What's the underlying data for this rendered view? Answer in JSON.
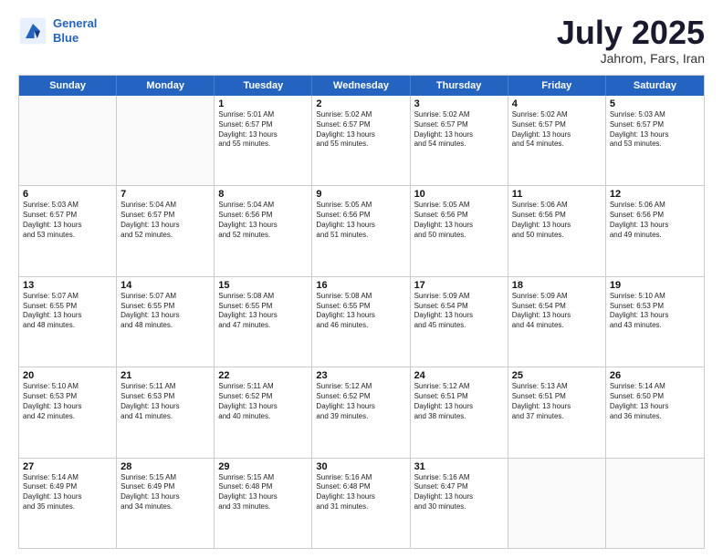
{
  "header": {
    "logo_line1": "General",
    "logo_line2": "Blue",
    "month": "July 2025",
    "location": "Jahrom, Fars, Iran"
  },
  "days": [
    "Sunday",
    "Monday",
    "Tuesday",
    "Wednesday",
    "Thursday",
    "Friday",
    "Saturday"
  ],
  "weeks": [
    [
      {
        "day": "",
        "empty": true
      },
      {
        "day": "",
        "empty": true
      },
      {
        "day": "1",
        "l1": "Sunrise: 5:01 AM",
        "l2": "Sunset: 6:57 PM",
        "l3": "Daylight: 13 hours",
        "l4": "and 55 minutes."
      },
      {
        "day": "2",
        "l1": "Sunrise: 5:02 AM",
        "l2": "Sunset: 6:57 PM",
        "l3": "Daylight: 13 hours",
        "l4": "and 55 minutes."
      },
      {
        "day": "3",
        "l1": "Sunrise: 5:02 AM",
        "l2": "Sunset: 6:57 PM",
        "l3": "Daylight: 13 hours",
        "l4": "and 54 minutes."
      },
      {
        "day": "4",
        "l1": "Sunrise: 5:02 AM",
        "l2": "Sunset: 6:57 PM",
        "l3": "Daylight: 13 hours",
        "l4": "and 54 minutes."
      },
      {
        "day": "5",
        "l1": "Sunrise: 5:03 AM",
        "l2": "Sunset: 6:57 PM",
        "l3": "Daylight: 13 hours",
        "l4": "and 53 minutes."
      }
    ],
    [
      {
        "day": "6",
        "l1": "Sunrise: 5:03 AM",
        "l2": "Sunset: 6:57 PM",
        "l3": "Daylight: 13 hours",
        "l4": "and 53 minutes."
      },
      {
        "day": "7",
        "l1": "Sunrise: 5:04 AM",
        "l2": "Sunset: 6:57 PM",
        "l3": "Daylight: 13 hours",
        "l4": "and 52 minutes."
      },
      {
        "day": "8",
        "l1": "Sunrise: 5:04 AM",
        "l2": "Sunset: 6:56 PM",
        "l3": "Daylight: 13 hours",
        "l4": "and 52 minutes."
      },
      {
        "day": "9",
        "l1": "Sunrise: 5:05 AM",
        "l2": "Sunset: 6:56 PM",
        "l3": "Daylight: 13 hours",
        "l4": "and 51 minutes."
      },
      {
        "day": "10",
        "l1": "Sunrise: 5:05 AM",
        "l2": "Sunset: 6:56 PM",
        "l3": "Daylight: 13 hours",
        "l4": "and 50 minutes."
      },
      {
        "day": "11",
        "l1": "Sunrise: 5:06 AM",
        "l2": "Sunset: 6:56 PM",
        "l3": "Daylight: 13 hours",
        "l4": "and 50 minutes."
      },
      {
        "day": "12",
        "l1": "Sunrise: 5:06 AM",
        "l2": "Sunset: 6:56 PM",
        "l3": "Daylight: 13 hours",
        "l4": "and 49 minutes."
      }
    ],
    [
      {
        "day": "13",
        "l1": "Sunrise: 5:07 AM",
        "l2": "Sunset: 6:55 PM",
        "l3": "Daylight: 13 hours",
        "l4": "and 48 minutes."
      },
      {
        "day": "14",
        "l1": "Sunrise: 5:07 AM",
        "l2": "Sunset: 6:55 PM",
        "l3": "Daylight: 13 hours",
        "l4": "and 48 minutes."
      },
      {
        "day": "15",
        "l1": "Sunrise: 5:08 AM",
        "l2": "Sunset: 6:55 PM",
        "l3": "Daylight: 13 hours",
        "l4": "and 47 minutes."
      },
      {
        "day": "16",
        "l1": "Sunrise: 5:08 AM",
        "l2": "Sunset: 6:55 PM",
        "l3": "Daylight: 13 hours",
        "l4": "and 46 minutes."
      },
      {
        "day": "17",
        "l1": "Sunrise: 5:09 AM",
        "l2": "Sunset: 6:54 PM",
        "l3": "Daylight: 13 hours",
        "l4": "and 45 minutes."
      },
      {
        "day": "18",
        "l1": "Sunrise: 5:09 AM",
        "l2": "Sunset: 6:54 PM",
        "l3": "Daylight: 13 hours",
        "l4": "and 44 minutes."
      },
      {
        "day": "19",
        "l1": "Sunrise: 5:10 AM",
        "l2": "Sunset: 6:53 PM",
        "l3": "Daylight: 13 hours",
        "l4": "and 43 minutes."
      }
    ],
    [
      {
        "day": "20",
        "l1": "Sunrise: 5:10 AM",
        "l2": "Sunset: 6:53 PM",
        "l3": "Daylight: 13 hours",
        "l4": "and 42 minutes."
      },
      {
        "day": "21",
        "l1": "Sunrise: 5:11 AM",
        "l2": "Sunset: 6:53 PM",
        "l3": "Daylight: 13 hours",
        "l4": "and 41 minutes."
      },
      {
        "day": "22",
        "l1": "Sunrise: 5:11 AM",
        "l2": "Sunset: 6:52 PM",
        "l3": "Daylight: 13 hours",
        "l4": "and 40 minutes."
      },
      {
        "day": "23",
        "l1": "Sunrise: 5:12 AM",
        "l2": "Sunset: 6:52 PM",
        "l3": "Daylight: 13 hours",
        "l4": "and 39 minutes."
      },
      {
        "day": "24",
        "l1": "Sunrise: 5:12 AM",
        "l2": "Sunset: 6:51 PM",
        "l3": "Daylight: 13 hours",
        "l4": "and 38 minutes."
      },
      {
        "day": "25",
        "l1": "Sunrise: 5:13 AM",
        "l2": "Sunset: 6:51 PM",
        "l3": "Daylight: 13 hours",
        "l4": "and 37 minutes."
      },
      {
        "day": "26",
        "l1": "Sunrise: 5:14 AM",
        "l2": "Sunset: 6:50 PM",
        "l3": "Daylight: 13 hours",
        "l4": "and 36 minutes."
      }
    ],
    [
      {
        "day": "27",
        "l1": "Sunrise: 5:14 AM",
        "l2": "Sunset: 6:49 PM",
        "l3": "Daylight: 13 hours",
        "l4": "and 35 minutes."
      },
      {
        "day": "28",
        "l1": "Sunrise: 5:15 AM",
        "l2": "Sunset: 6:49 PM",
        "l3": "Daylight: 13 hours",
        "l4": "and 34 minutes."
      },
      {
        "day": "29",
        "l1": "Sunrise: 5:15 AM",
        "l2": "Sunset: 6:48 PM",
        "l3": "Daylight: 13 hours",
        "l4": "and 33 minutes."
      },
      {
        "day": "30",
        "l1": "Sunrise: 5:16 AM",
        "l2": "Sunset: 6:48 PM",
        "l3": "Daylight: 13 hours",
        "l4": "and 31 minutes."
      },
      {
        "day": "31",
        "l1": "Sunrise: 5:16 AM",
        "l2": "Sunset: 6:47 PM",
        "l3": "Daylight: 13 hours",
        "l4": "and 30 minutes."
      },
      {
        "day": "",
        "empty": true
      },
      {
        "day": "",
        "empty": true
      }
    ]
  ]
}
